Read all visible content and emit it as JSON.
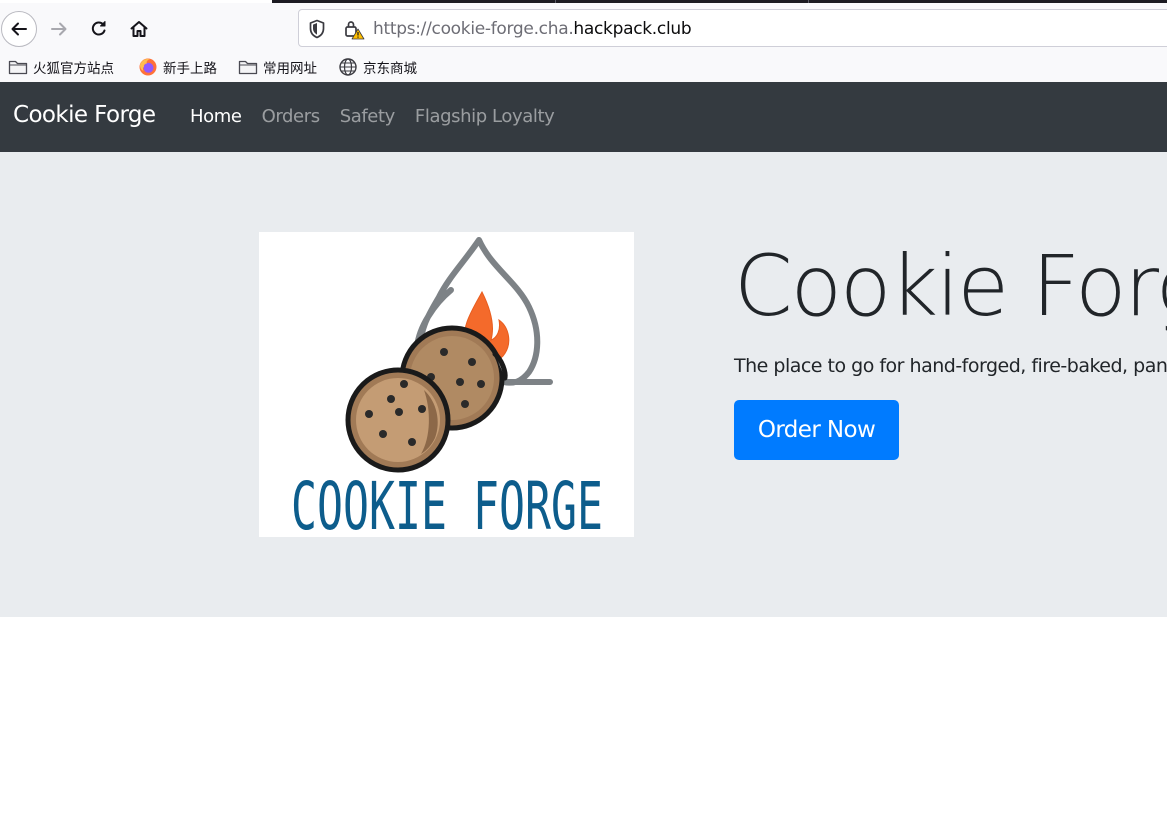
{
  "browser": {
    "url_host_prefix": "https://cookie-forge.cha.",
    "url_host_domain": "hackpack.club",
    "bookmarks": [
      {
        "label": "火狐官方站点",
        "icon": "folder-icon"
      },
      {
        "label": "新手上路",
        "icon": "firefox-icon"
      },
      {
        "label": "常用网址",
        "icon": "folder-icon"
      },
      {
        "label": "京东商城",
        "icon": "globe-icon"
      }
    ]
  },
  "navbar": {
    "brand": "Cookie Forge",
    "links": [
      {
        "label": "Home",
        "active": true
      },
      {
        "label": "Orders",
        "active": false
      },
      {
        "label": "Safety",
        "active": false
      },
      {
        "label": "Flagship Loyalty",
        "active": false
      }
    ]
  },
  "hero": {
    "logo_text": "COOKIE FORGE",
    "title": "Cookie Forge",
    "lead": "The place to go for hand-forged, fire-baked, pancake cookies!",
    "button_label": "Order Now"
  },
  "colors": {
    "navbar_bg": "#343a40",
    "jumbotron_bg": "#e9ecef",
    "primary": "#007bff",
    "logo_text": "#0d5d8c",
    "flame": "#f46a2b"
  }
}
